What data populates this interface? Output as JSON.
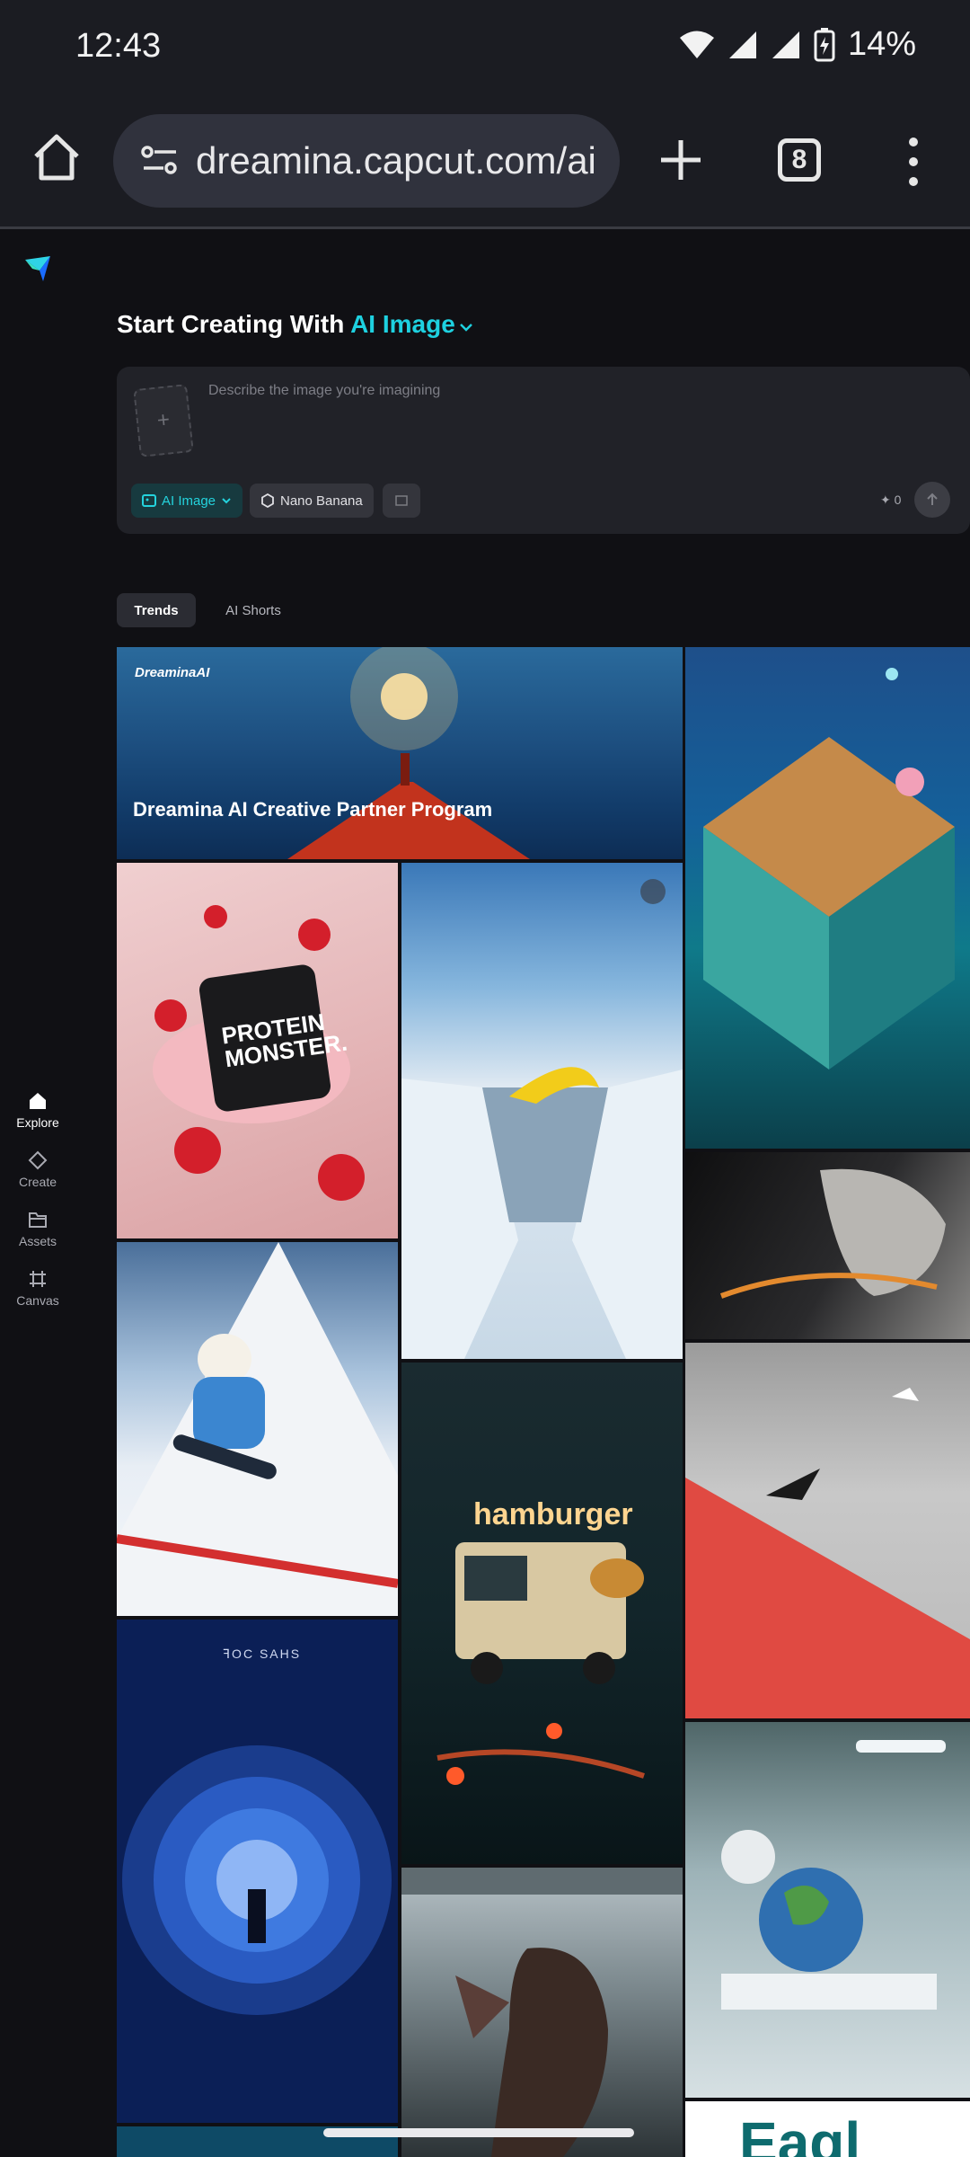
{
  "status_bar": {
    "time": "12:43",
    "battery": "14%"
  },
  "browser": {
    "url": "dreamina.capcut.com/ai",
    "tab_count": "8"
  },
  "sidebar": {
    "items": [
      {
        "label": "Explore",
        "icon": "home-icon",
        "active": true
      },
      {
        "label": "Create",
        "icon": "diamond-icon",
        "active": false
      },
      {
        "label": "Assets",
        "icon": "folder-icon",
        "active": false
      },
      {
        "label": "Canvas",
        "icon": "canvas-icon",
        "active": false
      }
    ]
  },
  "header": {
    "prefix": "Start Creating With",
    "mode": "AI Image"
  },
  "prompt": {
    "placeholder": "Describe the image you're imagining",
    "mode_chip": "AI Image",
    "model_chip": "Nano Banana",
    "credits": "0"
  },
  "tabs": [
    {
      "label": "Trends"
    },
    {
      "label": "AI Shorts"
    }
  ],
  "gallery": {
    "banner_title": "Dreamina AI Creative Partner Program",
    "banner_brand": "DreaminaAI",
    "protein_text_1": "PROTEIN",
    "protein_text_2": "MONSTER.",
    "hamburger_text": "hamburger",
    "poster_text": "ꟻOC SAHS",
    "partial_text": "Eagl"
  },
  "colors": {
    "accent": "#1ed1e0",
    "background": "#101014",
    "card": "#212228"
  }
}
